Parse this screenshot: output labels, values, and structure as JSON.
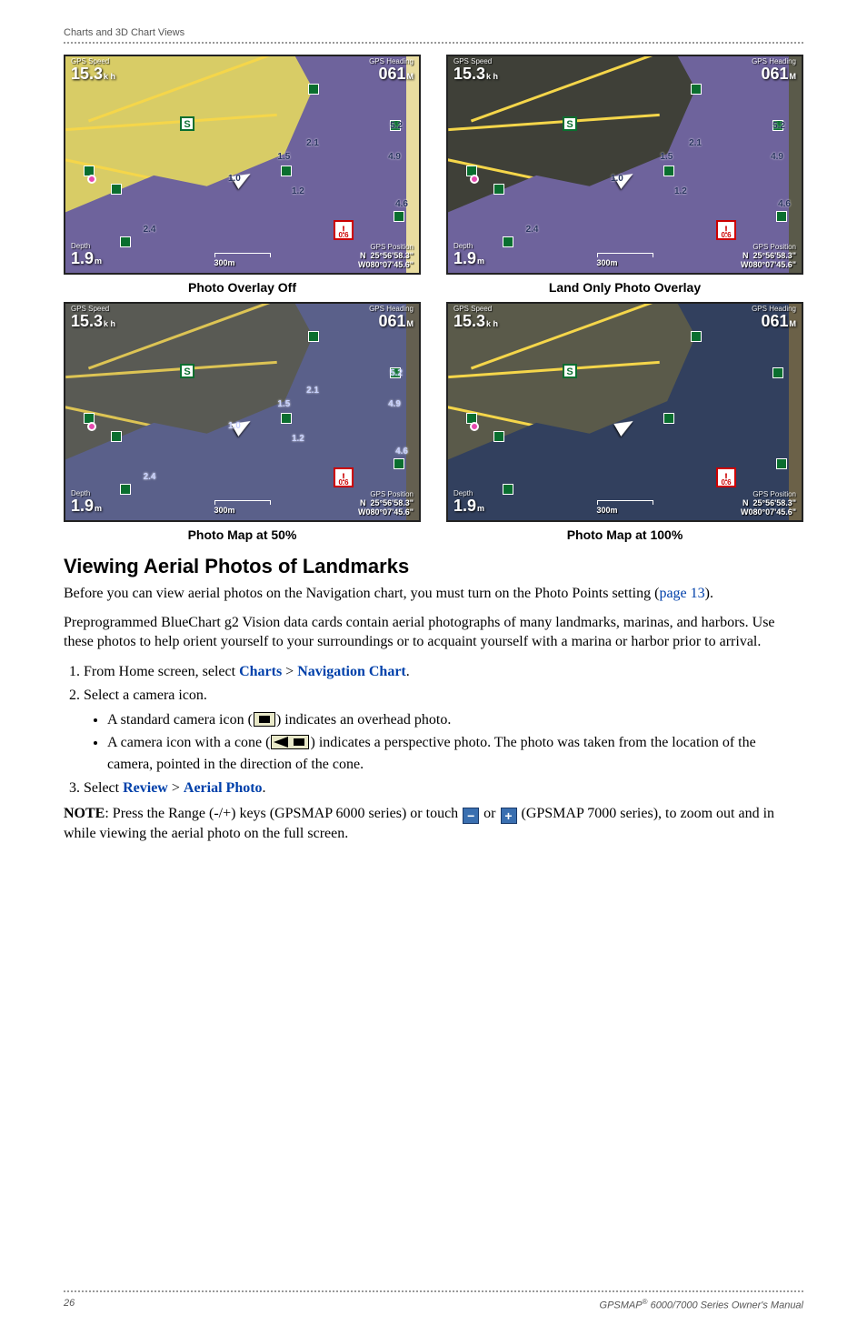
{
  "header": {
    "section_title": "Charts and 3D Chart Views"
  },
  "overlay_stats": {
    "gps_speed_label": "GPS Speed",
    "gps_speed_value": "15.3",
    "gps_speed_unit": "k h",
    "gps_heading_label": "GPS Heading",
    "gps_heading_value": "061",
    "gps_heading_unit": "M",
    "depth_label": "Depth",
    "depth_value": "1.9",
    "depth_unit": "m",
    "gps_position_label": "GPS Position",
    "gps_position_value": "N  25°56'58.3\"\nW080°07'45.6\"",
    "scale": "300m"
  },
  "depth_soundings": {
    "d1": "1.0",
    "d2": "1.5",
    "d3": "1.2",
    "d4": "2.4",
    "d5": "2.1",
    "d6": "4.9",
    "d7": "5.2",
    "d8": "4.6"
  },
  "hazard_value": "0.6",
  "captions": {
    "off": "Photo Overlay Off",
    "land": "Land Only Photo Overlay",
    "p50": "Photo Map at 50%",
    "p100": "Photo Map at 100%"
  },
  "section_heading": "Viewing Aerial Photos of Landmarks",
  "intro": {
    "pre": "Before you can view aerial photos on the Navigation chart, you must turn on the Photo Points setting (",
    "link": "page 13",
    "post": ")."
  },
  "para2": "Preprogrammed BlueChart g2 Vision data cards contain aerial photographs of many landmarks, marinas, and harbors. Use these photos to help orient yourself to your surroundings or to acquaint yourself with a marina or harbor prior to arrival.",
  "steps": {
    "s1_pre": "From Home screen, select ",
    "s1_m1": "Charts",
    "s1_sep": " > ",
    "s1_m2": "Navigation Chart",
    "s1_post": ".",
    "s2": "Select a camera icon.",
    "s2a_pre": "A standard camera icon (",
    "s2a_post": ") indicates an overhead photo.",
    "s2b_pre": "A camera icon with a cone (",
    "s2b_post": ") indicates a perspective photo. The photo was taken from the location of the camera, pointed in the direction of the cone.",
    "s3_pre": "Select ",
    "s3_m1": "Review",
    "s3_sep": " > ",
    "s3_m2": "Aerial Photo",
    "s3_post": "."
  },
  "note": {
    "lead": "NOTE",
    "pre": ": Press the Range (-/+) keys (GPSMAP 6000 series) or touch ",
    "mid": " or ",
    "post": " (GPSMAP 7000 series), to zoom out and in while viewing the aerial photo on the full screen.",
    "minus": "−",
    "plus": "+"
  },
  "footer": {
    "page": "26",
    "product_pre": "GPSMAP",
    "reg": "®",
    "product_post": " 6000/7000 Series Owner's Manual"
  }
}
